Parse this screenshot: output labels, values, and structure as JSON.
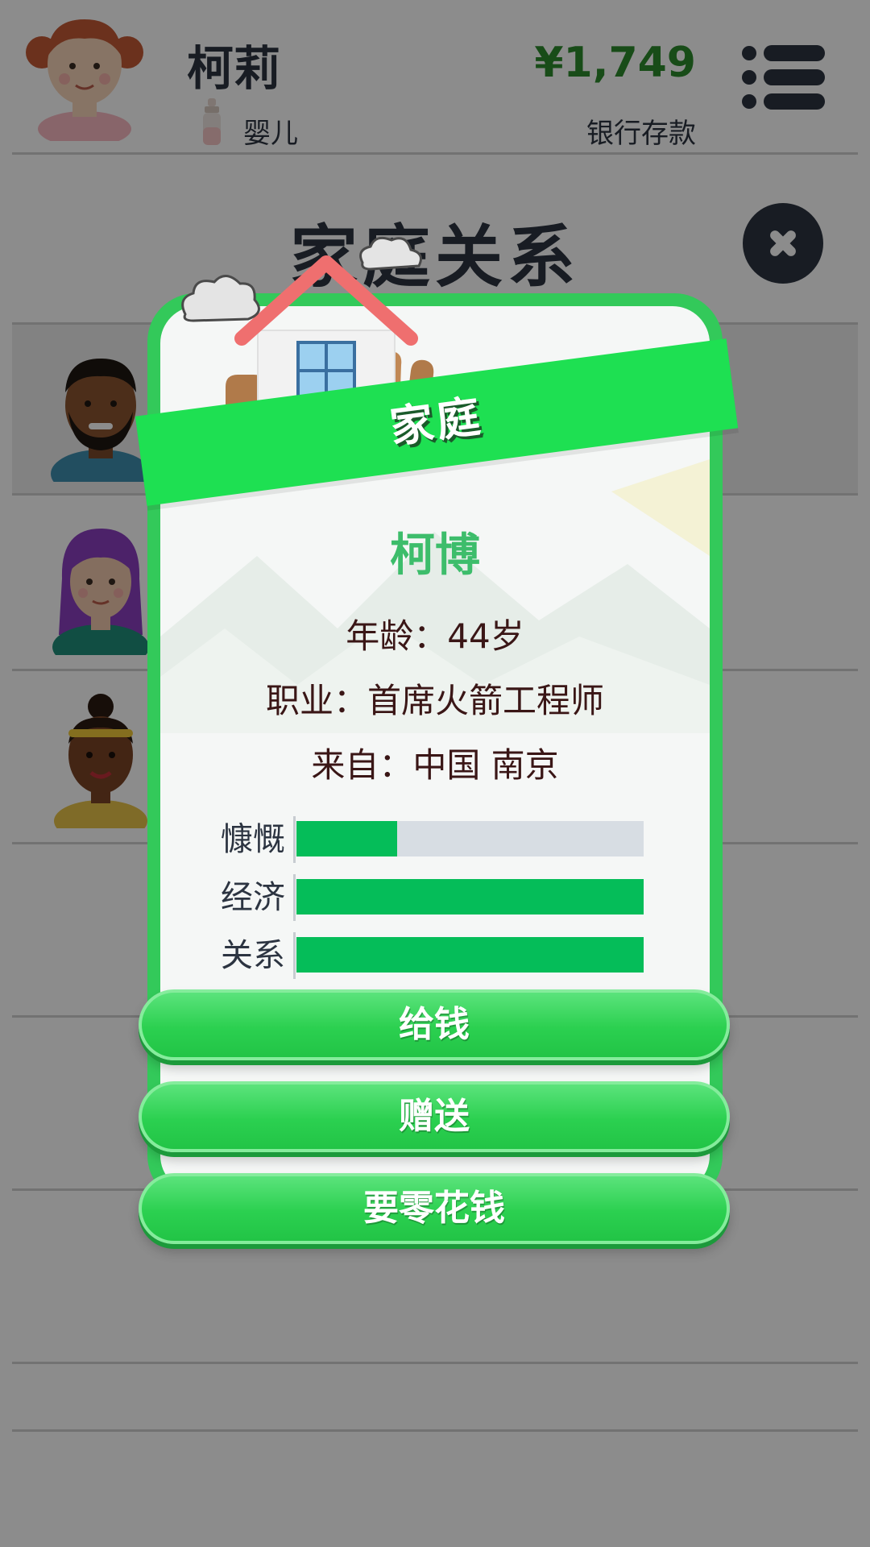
{
  "header": {
    "player_name": "柯莉",
    "life_stage": "婴儿",
    "money": "¥1,749",
    "money_label": "银行存款"
  },
  "page": {
    "title": "家庭关系"
  },
  "relationships": [
    {
      "avatar": "father-avatar"
    },
    {
      "avatar": "mother-avatar"
    },
    {
      "avatar": "sibling-avatar"
    }
  ],
  "modal": {
    "banner": "家庭",
    "person_name": "柯博",
    "age_line": "年龄：44岁",
    "job_line": "职业：首席火箭工程师",
    "from_line": "来自：中国 南京",
    "stats": [
      {
        "label": "慷慨",
        "value": 0.29
      },
      {
        "label": "经济",
        "value": 1.0
      },
      {
        "label": "关系",
        "value": 1.0
      }
    ],
    "buttons": {
      "give_money": "给钱",
      "gift": "赠送",
      "ask_allowance": "要零花钱"
    }
  },
  "colors": {
    "accent_green": "#33c95a",
    "banner_green": "#1ee052",
    "stat_fill": "#05bd59",
    "money_green": "#2d8a2d",
    "dark_text": "#2c3441"
  }
}
